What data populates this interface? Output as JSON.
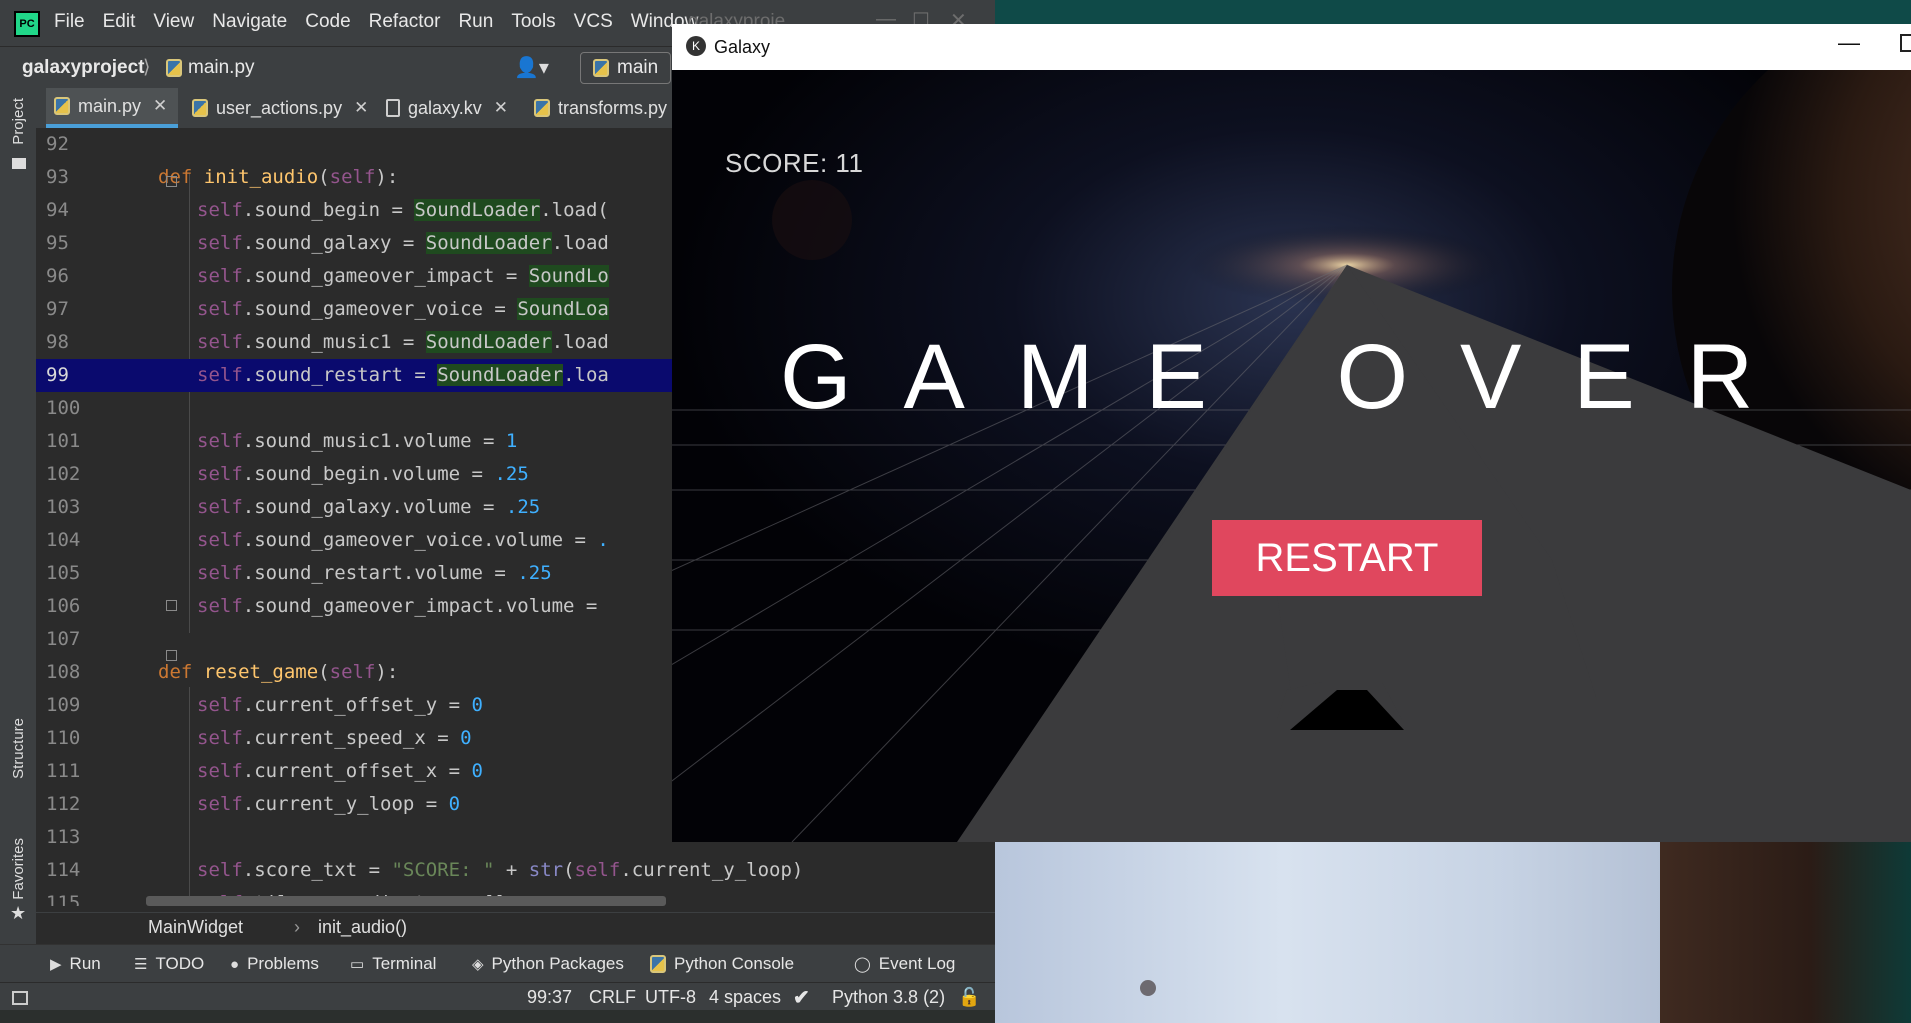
{
  "ide": {
    "logo_text": "PC",
    "menu": [
      "File",
      "Edit",
      "View",
      "Navigate",
      "Code",
      "Refactor",
      "Run",
      "Tools",
      "VCS",
      "Window"
    ],
    "window_title": "galaxyproje",
    "window_controls": [
      "—",
      "☐",
      "✕"
    ],
    "project_name": "galaxyproject",
    "current_file": "main.py",
    "branch": "main",
    "left_strip": {
      "project": "Project",
      "structure": "Structure",
      "favorites": "Favorites"
    },
    "tabs": [
      {
        "label": "main.py",
        "icon": "python-file-icon",
        "active": true
      },
      {
        "label": "user_actions.py",
        "icon": "python-file-icon",
        "active": false
      },
      {
        "label": "galaxy.kv",
        "icon": "kv-file-icon",
        "active": false
      },
      {
        "label": "transforms.py",
        "icon": "python-file-icon",
        "active": false
      }
    ],
    "code_lines": [
      {
        "n": "92"
      },
      {
        "n": "93",
        "text": "def init_audio(self):"
      },
      {
        "n": "94",
        "text": "self.sound_begin = SoundLoader.load("
      },
      {
        "n": "95",
        "text": "self.sound_galaxy = SoundLoader.load"
      },
      {
        "n": "96",
        "text": "self.sound_gameover_impact = SoundLo"
      },
      {
        "n": "97",
        "text": "self.sound_gameover_voice = SoundLoa"
      },
      {
        "n": "98",
        "text": "self.sound_music1 = SoundLoader.load"
      },
      {
        "n": "99",
        "text": "self.sound_restart = SoundLoader.loa"
      },
      {
        "n": "100"
      },
      {
        "n": "101",
        "text": "self.sound_music1.volume = 1"
      },
      {
        "n": "102",
        "text": "self.sound_begin.volume = .25"
      },
      {
        "n": "103",
        "text": "self.sound_galaxy.volume = .25"
      },
      {
        "n": "104",
        "text": "self.sound_gameover_voice.volume = ."
      },
      {
        "n": "105",
        "text": "self.sound_restart.volume = .25"
      },
      {
        "n": "106",
        "text": "self.sound_gameover_impact.volume = "
      },
      {
        "n": "107"
      },
      {
        "n": "108",
        "text": "def reset_game(self):"
      },
      {
        "n": "109",
        "text": "self.current_offset_y = 0"
      },
      {
        "n": "110",
        "text": "self.current_speed_x = 0"
      },
      {
        "n": "111",
        "text": "self.current_offset_x = 0"
      },
      {
        "n": "112",
        "text": "self.current_y_loop = 0"
      },
      {
        "n": "113"
      },
      {
        "n": "114",
        "text": "self.score_txt = \"SCORE: \" + str(self.current_y_loop)"
      },
      {
        "n": "115",
        "text": "self.tiles_coordinates = []"
      }
    ],
    "highlight_line": "99",
    "breadcrumb": [
      "MainWidget",
      "init_audio()"
    ],
    "tool_windows": [
      "Run",
      "TODO",
      "Problems",
      "Terminal",
      "Python Packages",
      "Python Console",
      "Event Log"
    ],
    "status": {
      "position": "99:37",
      "line_sep": "CRLF",
      "encoding": "UTF-8",
      "indent": "4 spaces",
      "interpreter": "Python 3.8 (2)"
    }
  },
  "game": {
    "window_title": "Galaxy",
    "minimize": "—",
    "score": "SCORE: 11",
    "title_text": "GAME OVER",
    "restart_label": "RESTART",
    "restart_color": "#e0475e"
  }
}
